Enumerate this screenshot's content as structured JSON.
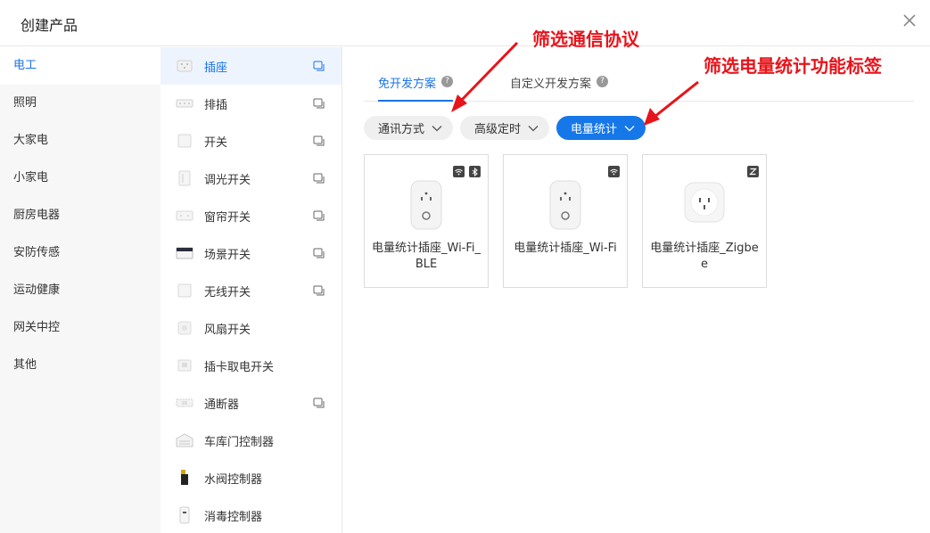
{
  "header": {
    "title": "创建产品"
  },
  "categories": [
    {
      "label": "电工",
      "active": true
    },
    {
      "label": "照明"
    },
    {
      "label": "大家电"
    },
    {
      "label": "小家电"
    },
    {
      "label": "厨房电器"
    },
    {
      "label": "安防传感"
    },
    {
      "label": "运动健康"
    },
    {
      "label": "网关中控"
    },
    {
      "label": "其他"
    }
  ],
  "subcategories": [
    {
      "label": "插座",
      "icon": "socket-icon",
      "active": true,
      "copy": true
    },
    {
      "label": "排插",
      "icon": "power-strip-icon",
      "copy": true
    },
    {
      "label": "开关",
      "icon": "switch-icon",
      "copy": true
    },
    {
      "label": "调光开关",
      "icon": "dimmer-switch-icon",
      "copy": true
    },
    {
      "label": "窗帘开关",
      "icon": "curtain-switch-icon",
      "copy": true
    },
    {
      "label": "场景开关",
      "icon": "scene-switch-icon",
      "copy": true
    },
    {
      "label": "无线开关",
      "icon": "wireless-switch-icon",
      "copy": true
    },
    {
      "label": "风扇开关",
      "icon": "fan-switch-icon"
    },
    {
      "label": "插卡取电开关",
      "icon": "card-switch-icon"
    },
    {
      "label": "通断器",
      "icon": "breaker-icon",
      "copy": true
    },
    {
      "label": "车库门控制器",
      "icon": "garage-door-icon"
    },
    {
      "label": "水阀控制器",
      "icon": "water-valve-icon"
    },
    {
      "label": "消毒控制器",
      "icon": "disinfection-icon"
    }
  ],
  "tabs": [
    {
      "label": "免开发方案",
      "active": true
    },
    {
      "label": "自定义开发方案"
    }
  ],
  "filters": [
    {
      "label": "通讯方式"
    },
    {
      "label": "高级定时"
    },
    {
      "label": "电量统计",
      "selected": true
    }
  ],
  "products": [
    {
      "name": "电量统计插座_Wi-Fi_BLE",
      "tags": [
        "wifi-icon",
        "bluetooth-icon"
      ]
    },
    {
      "name": "电量统计插座_Wi-Fi",
      "tags": [
        "wifi-icon"
      ]
    },
    {
      "name": "电量统计插座_Zigbee",
      "tags": [
        "zigbee-icon"
      ]
    }
  ],
  "annotations": [
    {
      "text": "筛选通信协议"
    },
    {
      "text": "筛选电量统计功能标签"
    }
  ],
  "colors": {
    "accent": "#1a73e8",
    "annotation": "#e8141b",
    "selected_filter": "#1677e8"
  }
}
